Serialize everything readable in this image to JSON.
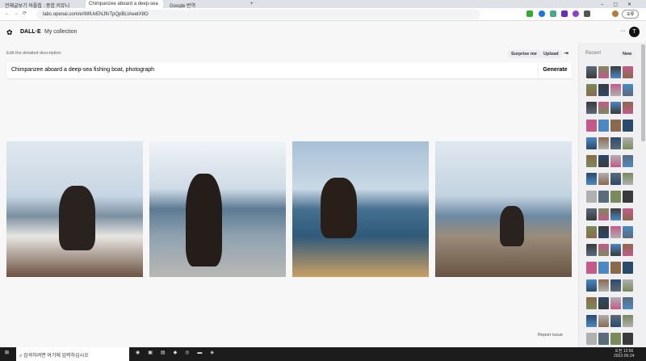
{
  "browser": {
    "tabs": [
      {
        "label": "전체글보기 와플칩 : 종합 커뮤니"
      },
      {
        "label": "Chimpanzee aboard a deep-sea"
      },
      {
        "label": "Google 번역"
      }
    ],
    "url": "labs.openai.com/e/iWlUvENJfnTpQpBLtAeetX8O",
    "profile_label": "오류"
  },
  "header": {
    "brand": "DALL·E",
    "nav": "My collection",
    "avatar_initial": "T",
    "more": "···"
  },
  "editor": {
    "label": "Edit the detailed description",
    "surprise": "Surprise me",
    "upload": "Upload",
    "prompt": "Chimpanzee aboard a deep-sea fishing boat, photograph",
    "generate": "Generate"
  },
  "results": [
    {
      "alt": "chimp on boat bow"
    },
    {
      "alt": "chimp standing at rail"
    },
    {
      "alt": "chimp on deck under net"
    },
    {
      "alt": "chimp on boat with ropes"
    }
  ],
  "report": "Report issue",
  "sidebar": {
    "title": "Recent",
    "new": "New"
  },
  "taskbar": {
    "search": "검색하려면 여기에 입력하십시오",
    "time": "오전 12:56",
    "date": "2022-06-24"
  }
}
